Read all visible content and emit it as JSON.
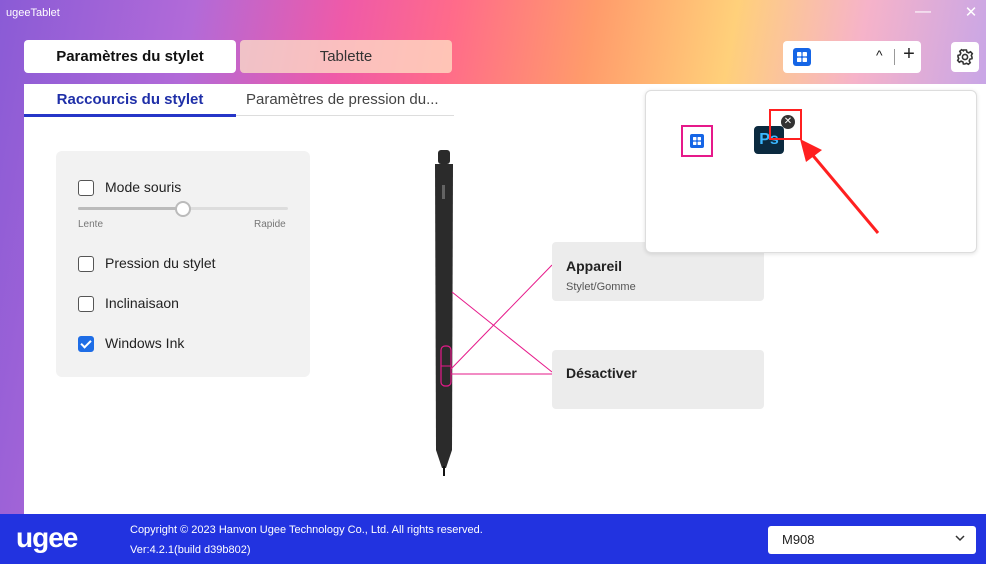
{
  "app": {
    "title": "ugeeTablet",
    "minimize_glyph": "—",
    "close_glyph": "✕"
  },
  "tabs": [
    {
      "label": "Paramètres du stylet",
      "active": true
    },
    {
      "label": "Tablette",
      "active": false
    }
  ],
  "app_selector": {
    "current_icon": "windows-app-icon",
    "collapse_glyph": "^",
    "add_glyph": "+"
  },
  "settings_icon": "gear-icon",
  "subtabs": [
    {
      "label": "Raccourcis du stylet",
      "active": true
    },
    {
      "label": "Paramètres de pression du...",
      "active": false
    }
  ],
  "options": {
    "mouse_mode": {
      "label": "Mode souris",
      "checked": false
    },
    "speed_slider": {
      "min_label": "Lente",
      "max_label": "Rapide",
      "value": 0.5
    },
    "pen_pressure": {
      "label": "Pression du stylet",
      "checked": false
    },
    "tilt": {
      "label": "Inclinaisaon",
      "checked": false
    },
    "windows_ink": {
      "label": "Windows Ink",
      "checked": true
    }
  },
  "pen_buttons": [
    {
      "title": "Appareil",
      "subtitle": "Stylet/Gomme"
    },
    {
      "title": "Désactiver",
      "subtitle": ""
    }
  ],
  "app_popup": {
    "apps": [
      {
        "name": "windows-app-icon",
        "selected": true
      },
      {
        "name": "photoshop-app-icon",
        "label": "Ps",
        "removable": true
      }
    ],
    "remove_glyph": "✕"
  },
  "footer": {
    "logo_text": "ugee",
    "copyright": "Copyright © 2023 Hanvon Ugee Technology Co., Ltd. All rights reserved.",
    "version": "Ver:4.2.1(build d39b802)",
    "device": "M908"
  },
  "colors": {
    "accent": "#2233e0",
    "highlight_pink": "#e6198a",
    "annotation_red": "#ff2020",
    "checkbox_blue": "#1e6de6"
  }
}
